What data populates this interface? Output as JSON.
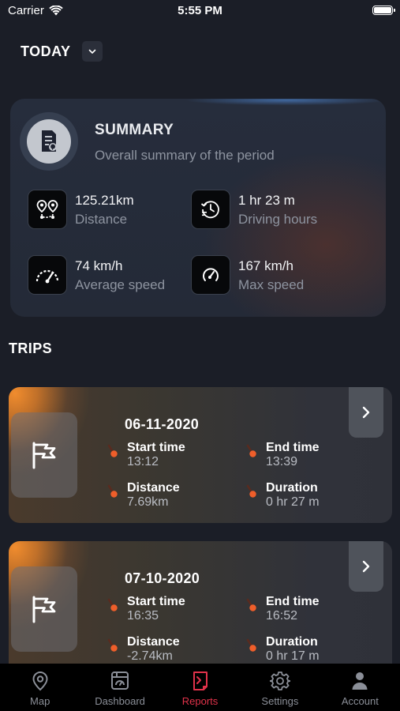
{
  "status_bar": {
    "carrier": "Carrier",
    "time": "5:55 PM"
  },
  "period": {
    "label": "TODAY"
  },
  "summary": {
    "title": "SUMMARY",
    "subtitle": "Overall summary of the period",
    "stats": [
      {
        "value": "125.21km",
        "label": "Distance",
        "icon": "route-pins-icon"
      },
      {
        "value": "1  hr 23  m",
        "label": "Driving hours",
        "icon": "history-clock-icon"
      },
      {
        "value": "74 km/h",
        "label": "Average speed",
        "icon": "speedometer-icon"
      },
      {
        "value": "167 km/h",
        "label": "Max speed",
        "icon": "gauge-icon"
      }
    ]
  },
  "trips": {
    "title": "TRIPS",
    "items": [
      {
        "date": "06-11-2020",
        "start_label": "Start time",
        "start_value": "13:12",
        "end_label": "End time",
        "end_value": "13:39",
        "distance_label": "Distance",
        "distance_value": "7.69km",
        "duration_label": "Duration",
        "duration_value": "0  hr 27  m"
      },
      {
        "date": "07-10-2020",
        "start_label": "Start time",
        "start_value": "16:35",
        "end_label": "End time",
        "end_value": "16:52",
        "distance_label": "Distance",
        "distance_value": "-2.74km",
        "duration_label": "Duration",
        "duration_value": "0  hr 17  m"
      }
    ]
  },
  "tabs": [
    {
      "label": "Map",
      "icon": "map-pin-icon"
    },
    {
      "label": "Dashboard",
      "icon": "dashboard-icon"
    },
    {
      "label": "Reports",
      "icon": "reports-icon",
      "active": true
    },
    {
      "label": "Settings",
      "icon": "gear-icon"
    },
    {
      "label": "Account",
      "icon": "user-icon"
    }
  ],
  "colors": {
    "accent": "#e1324a",
    "background": "#1b1e27",
    "trip_glow": "#f08c2e"
  }
}
